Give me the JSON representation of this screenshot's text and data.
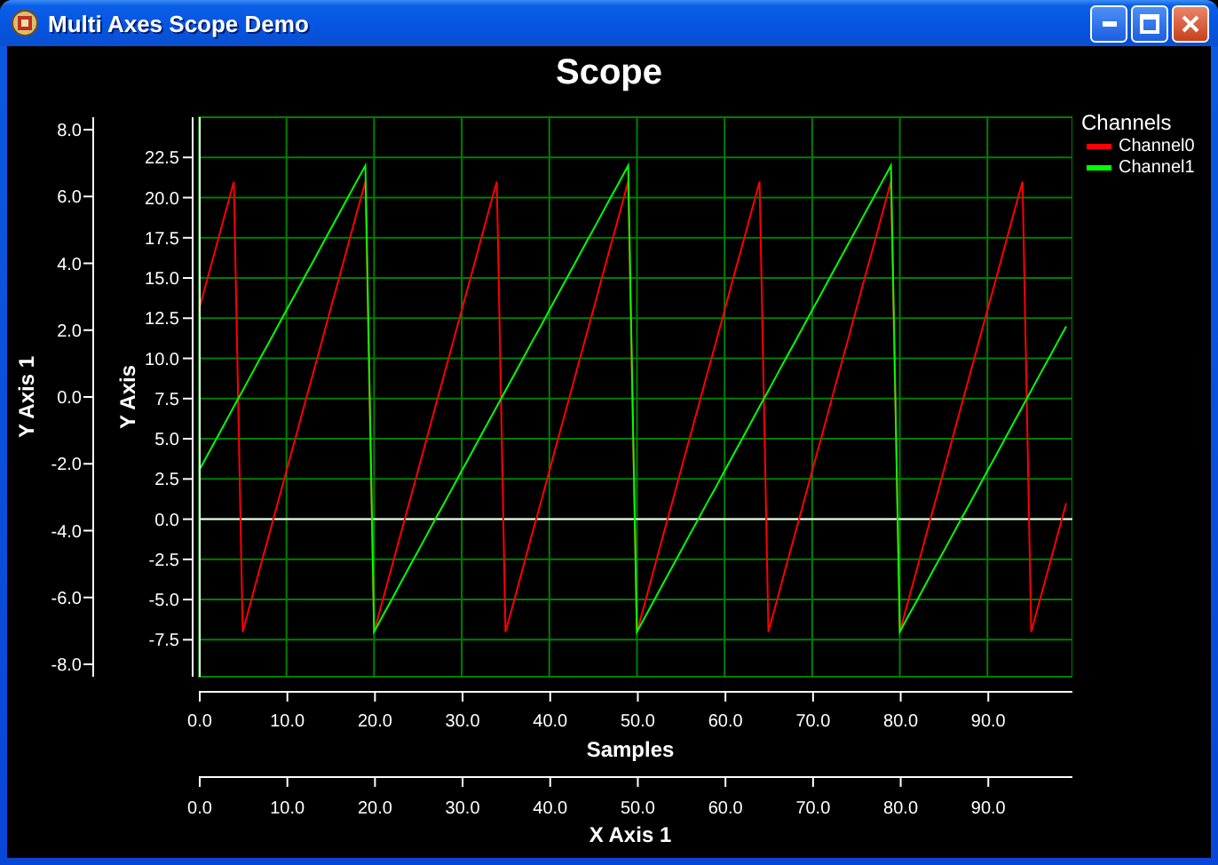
{
  "window": {
    "title": "Multi Axes Scope Demo"
  },
  "chart": {
    "legend": {
      "title": "Channels"
    },
    "chart_data": {
      "type": "line",
      "title": "Scope",
      "xlabel": "Samples",
      "ylabel": "Y Axis",
      "grid": true,
      "x": [
        0,
        1,
        2,
        3,
        4,
        5,
        6,
        7,
        8,
        9,
        10,
        11,
        12,
        13,
        14,
        15,
        16,
        17,
        18,
        19,
        20,
        21,
        22,
        23,
        24,
        25,
        26,
        27,
        28,
        29,
        30,
        31,
        32,
        33,
        34,
        35,
        36,
        37,
        38,
        39,
        40,
        41,
        42,
        43,
        44,
        45,
        46,
        47,
        48,
        49,
        50,
        51,
        52,
        53,
        54,
        55,
        56,
        57,
        58,
        59,
        60,
        61,
        62,
        63,
        64,
        65,
        66,
        67,
        68,
        69,
        70,
        71,
        72,
        73,
        74,
        75,
        76,
        77,
        78,
        79,
        80,
        81,
        82,
        83,
        84,
        85,
        86,
        87,
        88,
        89,
        90,
        91,
        92,
        93,
        94,
        95,
        96,
        97,
        98,
        99
      ],
      "xlim": [
        0,
        99.7
      ],
      "ylim": [
        -9.8,
        25
      ],
      "xticks": [
        {
          "value": 0,
          "label": "0.0"
        },
        {
          "value": 10,
          "label": "10.0"
        },
        {
          "value": 20,
          "label": "20.0"
        },
        {
          "value": 30,
          "label": "30.0"
        },
        {
          "value": 40,
          "label": "40.0"
        },
        {
          "value": 50,
          "label": "50.0"
        },
        {
          "value": 60,
          "label": "60.0"
        },
        {
          "value": 70,
          "label": "70.0"
        },
        {
          "value": 80,
          "label": "80.0"
        },
        {
          "value": 90,
          "label": "90.0"
        }
      ],
      "yticks": [
        {
          "value": -7.5,
          "label": "-7.5"
        },
        {
          "value": -5,
          "label": "-5.0"
        },
        {
          "value": -2.5,
          "label": "-2.5"
        },
        {
          "value": 0,
          "label": "0.0"
        },
        {
          "value": 2.5,
          "label": "2.5"
        },
        {
          "value": 5,
          "label": "5.0"
        },
        {
          "value": 7.5,
          "label": "7.5"
        },
        {
          "value": 10,
          "label": "10.0"
        },
        {
          "value": 12.5,
          "label": "12.5"
        },
        {
          "value": 15,
          "label": "15.0"
        },
        {
          "value": 17.5,
          "label": "17.5"
        },
        {
          "value": 20,
          "label": "20.0"
        },
        {
          "value": 22.5,
          "label": "22.5"
        }
      ],
      "series": [
        {
          "name": "Channel0",
          "color": "#ff0000",
          "values": [
            13,
            15,
            17,
            19,
            21,
            -7,
            -5,
            -3,
            -1,
            1,
            3,
            5,
            7,
            9,
            11,
            13,
            15,
            17,
            19,
            21,
            -7,
            -5,
            -3,
            -1,
            1,
            3,
            5,
            7,
            9,
            11,
            13,
            15,
            17,
            19,
            21,
            -7,
            -5,
            -3,
            -1,
            1,
            3,
            5,
            7,
            9,
            11,
            13,
            15,
            17,
            19,
            21,
            -7,
            -5,
            -3,
            -1,
            1,
            3,
            5,
            7,
            9,
            11,
            13,
            15,
            17,
            19,
            21,
            -7,
            -5,
            -3,
            -1,
            1,
            3,
            5,
            7,
            9,
            11,
            13,
            15,
            17,
            19,
            21,
            -7,
            -5,
            -3,
            -1,
            1,
            3,
            5,
            7,
            9,
            11,
            13,
            15,
            17,
            19,
            21,
            -7,
            -5,
            -3,
            -1,
            1
          ]
        },
        {
          "name": "Channel1",
          "color": "#00ff00",
          "values": [
            3,
            4,
            5,
            6,
            7,
            8,
            9,
            10,
            11,
            12,
            13,
            14,
            15,
            16,
            17,
            18,
            19,
            20,
            21,
            22,
            -7,
            -6,
            -5,
            -4,
            -3,
            -2,
            -1,
            0,
            1,
            2,
            3,
            4,
            5,
            6,
            7,
            8,
            9,
            10,
            11,
            12,
            13,
            14,
            15,
            16,
            17,
            18,
            19,
            20,
            21,
            22,
            -7,
            -6,
            -5,
            -4,
            -3,
            -2,
            -1,
            0,
            1,
            2,
            3,
            4,
            5,
            6,
            7,
            8,
            9,
            10,
            11,
            12,
            13,
            14,
            15,
            16,
            17,
            18,
            19,
            20,
            21,
            22,
            -7,
            -6,
            -5,
            -4,
            -3,
            -2,
            -1,
            0,
            1,
            2,
            3,
            4,
            5,
            6,
            7,
            8,
            9,
            10,
            11,
            12
          ]
        }
      ]
    },
    "extra_axes": [
      {
        "kind": "y",
        "label": "Y Axis 1",
        "ticks": [
          "8.0",
          "6.0",
          "4.0",
          "2.0",
          "0.0",
          "-2.0",
          "-4.0",
          "-6.0",
          "-8.0"
        ]
      },
      {
        "kind": "x",
        "label": "X Axis 1",
        "ticks": [
          "0.0",
          "10.0",
          "20.0",
          "30.0",
          "40.0",
          "50.0",
          "60.0",
          "70.0",
          "80.0",
          "90.0"
        ]
      }
    ]
  }
}
